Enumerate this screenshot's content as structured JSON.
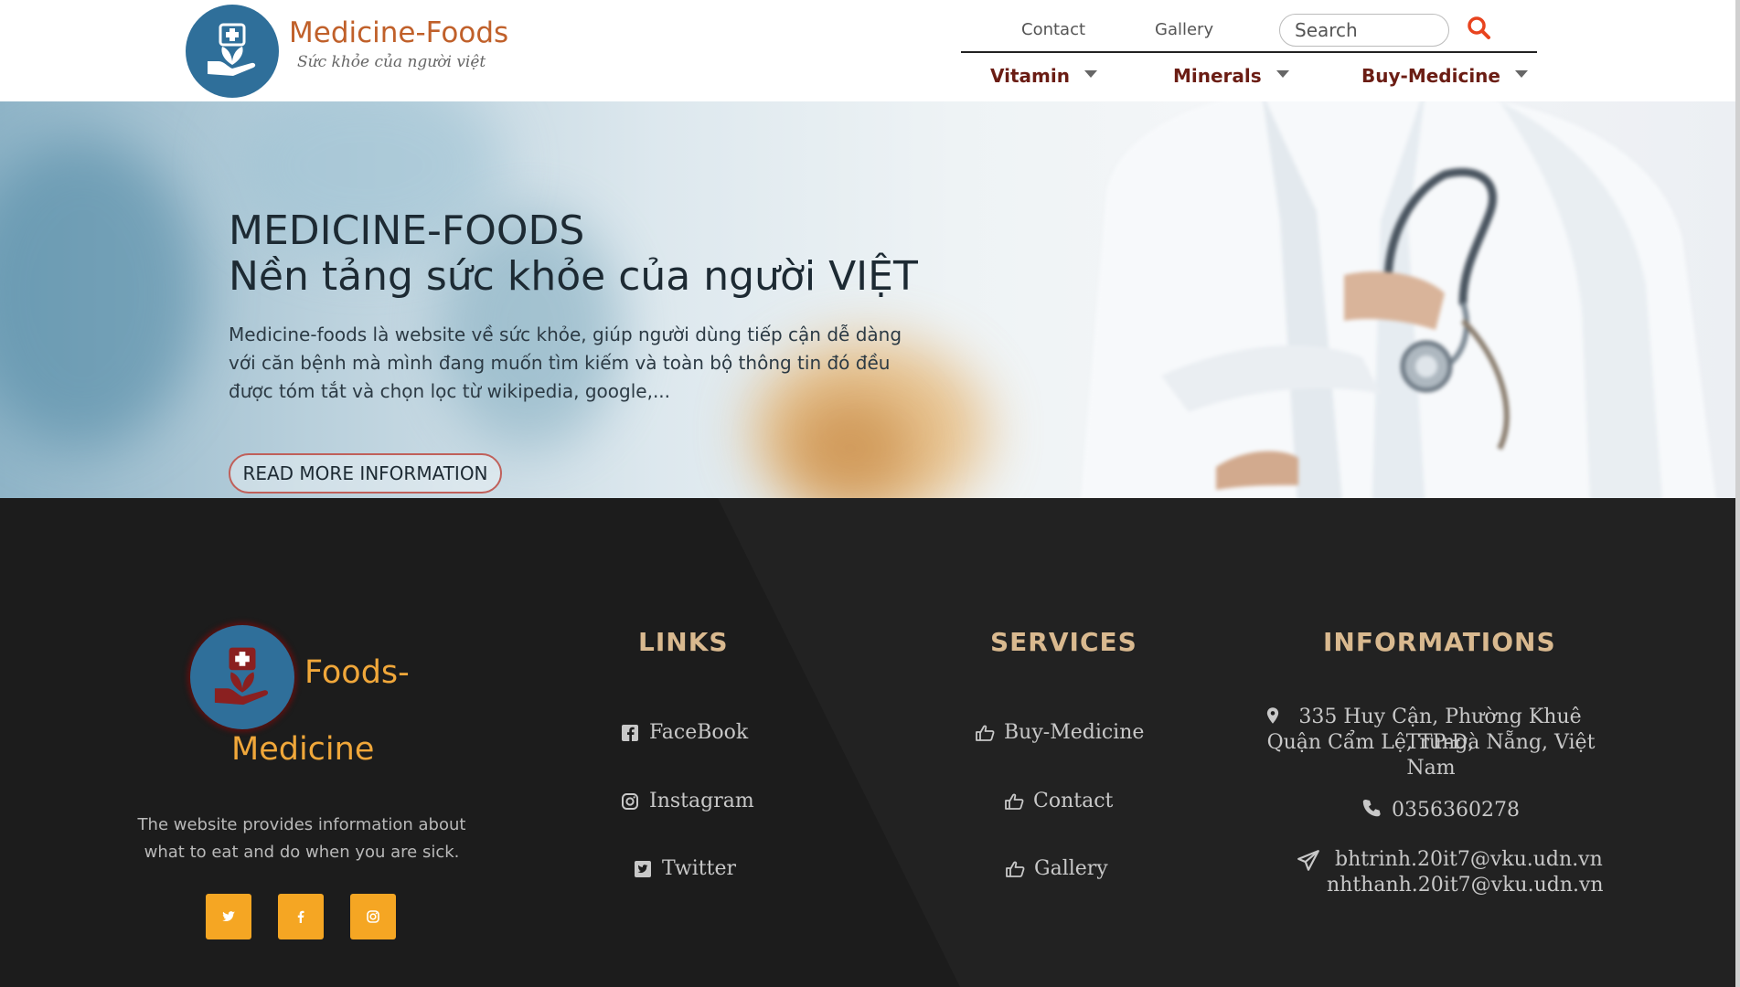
{
  "header": {
    "brand_title": "Medicine-Foods",
    "brand_subtitle": "Sức khỏe của người việt",
    "top_links": [
      "Contact",
      "Gallery"
    ],
    "search_placeholder": "Search",
    "menu": [
      "Vitamin",
      "Minerals",
      "Buy-Medicine"
    ]
  },
  "hero": {
    "title_line1": "MEDICINE-FOODS",
    "title_line2": "Nền tảng sức khỏe của người VIỆT",
    "description": "Medicine-foods là website về sức khỏe, giúp người dùng tiếp cận dễ dàng với căn bệnh mà mình đang muốn tìm kiếm và toàn bộ thông tin đó đều được tóm tắt và chọn lọc từ wikipedia, google,...",
    "button_label": "READ MORE INFORMATION"
  },
  "footer": {
    "brand_line1": "Foods-",
    "brand_line2": "Medicine",
    "description": "The website provides information about what to eat and do when you are sick.",
    "social": [
      "twitter-icon",
      "facebook-icon",
      "instagram-icon"
    ],
    "links_heading": "LINKS",
    "links": [
      "FaceBook",
      "Instagram",
      "Twitter"
    ],
    "services_heading": "SERVICES",
    "services": [
      "Buy-Medicine",
      "Contact",
      "Gallery"
    ],
    "info_heading": "INFORMATIONS",
    "address_line1": "335 Huy Cận, Phường Khuê Trung,",
    "address_line2": "Quận Cẩm Lệ, TP-Đà Nẵng, Việt Nam",
    "phone": "0356360278",
    "email1": "bhtrinh.20it7@vku.udn.vn",
    "email2": "nhthanh.20it7@vku.udn.vn"
  },
  "colors": {
    "brand_orange": "#c0602a",
    "menu_maroon": "#6b1d14",
    "footer_bg": "#1c1c1c",
    "accent_yellow": "#f5a623",
    "heading_tan": "#d9b98f",
    "logo_blue": "#2f6f9a"
  }
}
